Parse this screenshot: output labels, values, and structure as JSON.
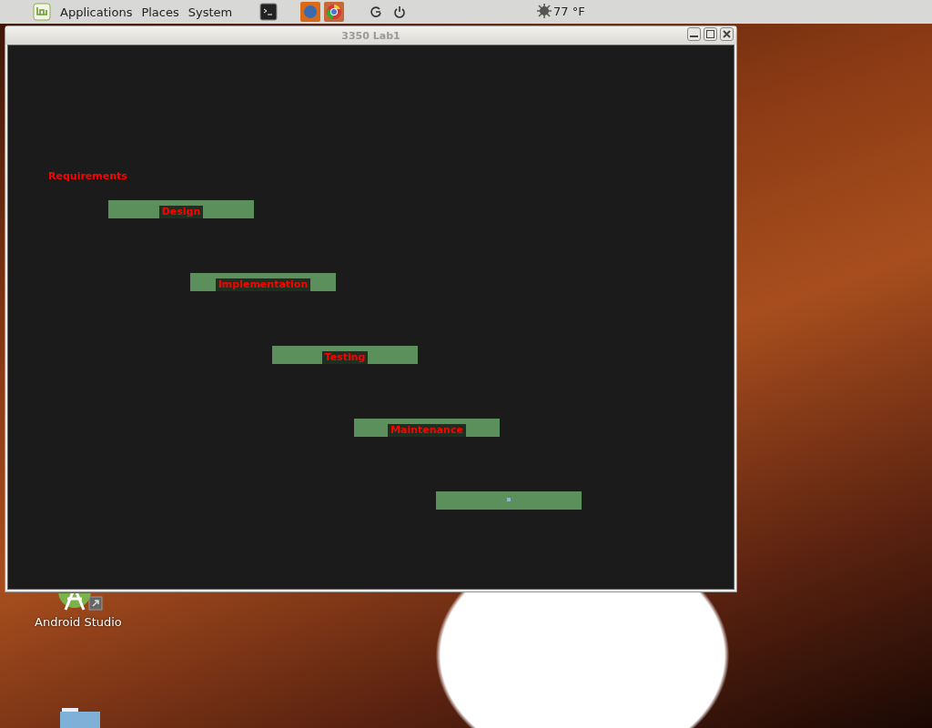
{
  "panel": {
    "menus": [
      "Applications",
      "Places",
      "System"
    ],
    "weather": "77 °F"
  },
  "window": {
    "title": "3350 Lab1"
  },
  "stages": [
    {
      "label": "Requirements",
      "bar": false
    },
    {
      "label": "Design",
      "bar": true
    },
    {
      "label": "Implementation",
      "bar": true
    },
    {
      "label": "Testing",
      "bar": true
    },
    {
      "label": "Maintenance",
      "bar": true
    },
    {
      "bar": true
    }
  ],
  "desktop_icons": [
    {
      "label": "Android Studio",
      "kind": "app"
    },
    {
      "kind": "folder"
    }
  ]
}
